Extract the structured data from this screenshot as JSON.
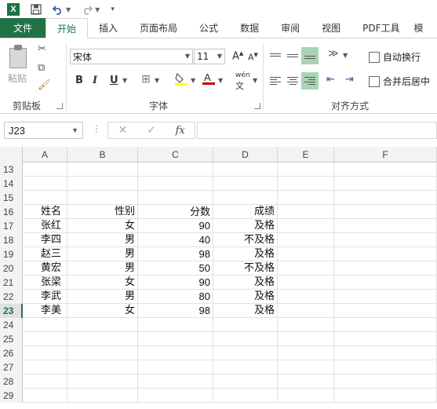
{
  "titlebar": {
    "app_icon": "excel-icon",
    "save_icon": "save-icon",
    "undo_icon": "undo-icon",
    "redo_icon": "redo-icon",
    "customize_icon": "customize-qat-icon"
  },
  "tabs": [
    {
      "label": "文件"
    },
    {
      "label": "开始"
    },
    {
      "label": "插入"
    },
    {
      "label": "页面布局"
    },
    {
      "label": "公式"
    },
    {
      "label": "数据"
    },
    {
      "label": "审阅"
    },
    {
      "label": "视图"
    },
    {
      "label": "PDF工具"
    },
    {
      "label": "模"
    }
  ],
  "ribbon": {
    "clipboard": {
      "label": "剪贴板",
      "paste_label": "粘贴"
    },
    "font": {
      "label": "字体",
      "font_name": "宋体",
      "font_size": "11",
      "bold": "B",
      "italic": "I",
      "underline": "U",
      "phonetic": "wén",
      "grow": "A",
      "shrink": "A",
      "font_color_letter": "A"
    },
    "alignment": {
      "label": "对齐方式",
      "wrap_text": "自动换行",
      "merge_center": "合并后居中"
    }
  },
  "formula_bar": {
    "name_box": "J23",
    "formula": "",
    "fx_label": "fx"
  },
  "sheet": {
    "columns": [
      "A",
      "B",
      "C",
      "D",
      "E",
      "F"
    ],
    "rows": [
      {
        "num": "13",
        "cells": [
          "",
          "",
          "",
          ""
        ]
      },
      {
        "num": "14",
        "cells": [
          "",
          "",
          "",
          ""
        ]
      },
      {
        "num": "15",
        "cells": [
          "",
          "",
          "",
          ""
        ]
      },
      {
        "num": "16",
        "cells": [
          "姓名",
          "性别",
          "分数",
          "成绩"
        ]
      },
      {
        "num": "17",
        "cells": [
          "张红",
          "女",
          "90",
          "及格"
        ]
      },
      {
        "num": "18",
        "cells": [
          "李四",
          "男",
          "40",
          "不及格"
        ]
      },
      {
        "num": "19",
        "cells": [
          "赵三",
          "男",
          "98",
          "及格"
        ]
      },
      {
        "num": "20",
        "cells": [
          "黄宏",
          "男",
          "50",
          "不及格"
        ]
      },
      {
        "num": "21",
        "cells": [
          "张梁",
          "女",
          "90",
          "及格"
        ]
      },
      {
        "num": "22",
        "cells": [
          "李武",
          "男",
          "80",
          "及格"
        ]
      },
      {
        "num": "23",
        "cells": [
          "李美",
          "女",
          "98",
          "及格"
        ]
      },
      {
        "num": "24",
        "cells": [
          "",
          "",
          "",
          ""
        ]
      },
      {
        "num": "25",
        "cells": [
          "",
          "",
          "",
          ""
        ]
      },
      {
        "num": "26",
        "cells": [
          "",
          "",
          "",
          ""
        ]
      },
      {
        "num": "27",
        "cells": [
          "",
          "",
          "",
          ""
        ]
      },
      {
        "num": "28",
        "cells": [
          "",
          "",
          "",
          ""
        ]
      },
      {
        "num": "29",
        "cells": [
          "",
          "",
          "",
          ""
        ]
      }
    ],
    "selected_row": "23"
  },
  "colors": {
    "accent": "#217346",
    "highlight_fill": "#ffff00",
    "font_color": "#c00000",
    "align_active": "#a9d3b5"
  }
}
